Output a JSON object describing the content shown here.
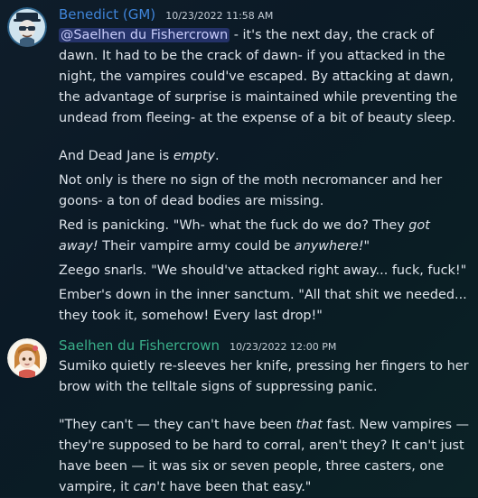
{
  "messages": [
    {
      "author": "Benedict (GM)",
      "timestamp": "10/23/2022 11:58 AM",
      "avatar_color": "#2a5f86",
      "name_color": "#3f84d8",
      "p1_mention": "@Saelhen du Fishercrown",
      "p1_text": " - it's the next day, the crack of dawn. It had to be the crack of dawn- if you attacked in the night, the vampires could've escaped. By attacking at dawn, the advantage of surprise is maintained while preventing the undead from fleeing- at the expense of a bit of beauty sleep.",
      "p2_text": "And Dead Jane is ",
      "p2_em": "empty",
      "p2_end": ".",
      "p3_text": "Not only is there no sign of the moth necromancer and her goons- a ton of dead bodies are missing.",
      "p4_a": "Red is panicking. \"Wh- what the fuck do we do? They ",
      "p4_em1": "got away!",
      "p4_b": " Their vampire army could be ",
      "p4_em2": "anywhere!\"",
      "p5_text": "Zeego snarls. \"We should've attacked right away... fuck, fuck!\"",
      "p6_text": "Ember's down in the inner sanctum. \"All that shit we needed... they took it, somehow! Every last drop!\""
    },
    {
      "author": "Saelhen du Fishercrown",
      "timestamp": "10/23/2022 12:00 PM",
      "name_color": "#3ab08a",
      "p1_text": "Sumiko quietly re-sleeves her knife, pressing her fingers to her brow with the telltale signs of suppressing panic.",
      "p2_a": "\"They can't — they can't have been ",
      "p2_em1": "that",
      "p2_b": " fast. New vampires — they're supposed to be hard to corral, aren't they? It can't just have been — it was six or seven people, three casters, one vampire, it ",
      "p2_em2": "can't",
      "p2_c": " have been that easy.\""
    }
  ]
}
